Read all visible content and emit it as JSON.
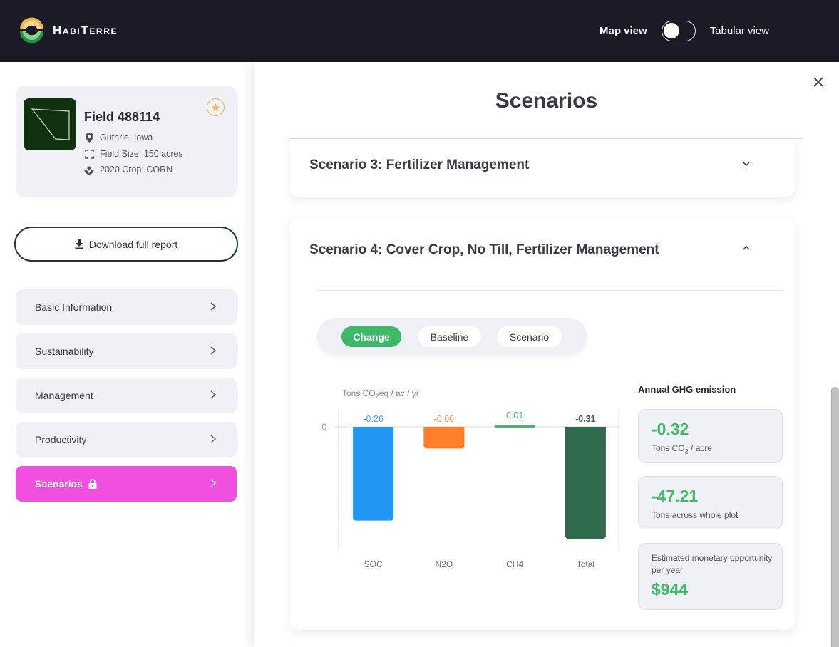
{
  "app": {
    "brand": "HabiTerre",
    "view_toggle": {
      "left_label": "Map view",
      "right_label": "Tabular view",
      "state": "Map view"
    }
  },
  "field": {
    "title": "Field 488114",
    "location": "Guthrie, Iowa",
    "size": "Field Size: 150 acres",
    "crop": "2020 Crop: CORN",
    "favorite": true
  },
  "actions": {
    "download_label": "Download full report"
  },
  "nav": {
    "items": [
      {
        "label": "Basic Information",
        "active": false,
        "locked": false
      },
      {
        "label": "Sustainability",
        "active": false,
        "locked": false
      },
      {
        "label": "Management",
        "active": false,
        "locked": false
      },
      {
        "label": "Productivity",
        "active": false,
        "locked": false
      },
      {
        "label": "Scenarios",
        "active": true,
        "locked": true
      }
    ]
  },
  "modal": {
    "title": "Scenarios",
    "accordions": [
      {
        "title": "Scenario 3: Fertilizer Management",
        "expanded": false
      },
      {
        "title": "Scenario 4: Cover Crop, No Till, Fertilizer Management",
        "expanded": true
      }
    ],
    "segments": [
      {
        "label": "Change",
        "active": true
      },
      {
        "label": "Baseline",
        "active": false
      },
      {
        "label": "Scenario",
        "active": false
      }
    ],
    "ghg": {
      "title": "Annual GHG emission",
      "per_acre_value": "-0.32",
      "per_acre_label_pre": "Tons CO",
      "per_acre_label_sub": "2",
      "per_acre_label_post": " / acre",
      "whole_plot_value": "-47.21",
      "whole_plot_label": "Tons across whole plot",
      "monetary_label": "Estimated monetary opportunity per year",
      "monetary_value": "$944"
    }
  },
  "chart_data": {
    "type": "bar",
    "title": "",
    "ylabel": "Tons CO2eq / ac / yr",
    "ylabel_pre": "Tons CO",
    "ylabel_sub": "2",
    "ylabel_post": "eq / ac / yr",
    "xlabel": "",
    "categories": [
      "SOC",
      "N2O",
      "CH4",
      "Total"
    ],
    "values": [
      -0.26,
      -0.06,
      0.01,
      -0.31
    ],
    "data_labels": [
      "-0.26",
      "-0.06",
      "0.01",
      "-0.31"
    ],
    "colors": [
      "#2196f3",
      "#fd7e2b",
      "#3dba67",
      "#2f6a4c"
    ],
    "label_colors": [
      "#4aa3f5",
      "#fd8a45",
      "#4cbd76",
      "#3b5548"
    ],
    "y_ticks": [
      0
    ],
    "ylim": [
      -0.33,
      0.03
    ],
    "grid": false,
    "legend": "none"
  },
  "colors": {
    "accent_green": "#3dba67",
    "nav_active": "#f04fdf",
    "topbar": "#191c27",
    "star": "#f2b53c"
  }
}
